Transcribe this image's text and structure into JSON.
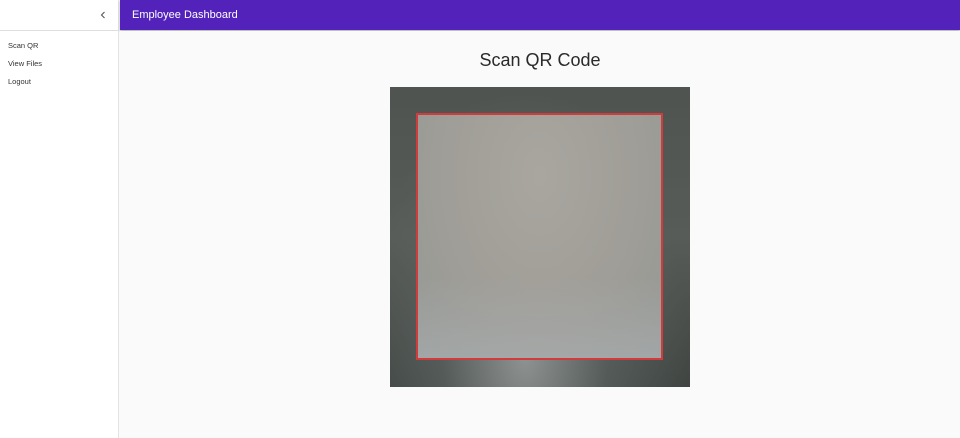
{
  "header": {
    "title": "Employee Dashboard"
  },
  "sidebar": {
    "collapse_icon": "chevron-left-icon",
    "items": [
      {
        "label": "Scan QR"
      },
      {
        "label": "View Files"
      },
      {
        "label": "Logout"
      }
    ]
  },
  "main": {
    "title": "Scan QR Code"
  },
  "colors": {
    "appbar": "#5222bb",
    "scan_border": "#d23b3b",
    "background": "#fafafa"
  }
}
